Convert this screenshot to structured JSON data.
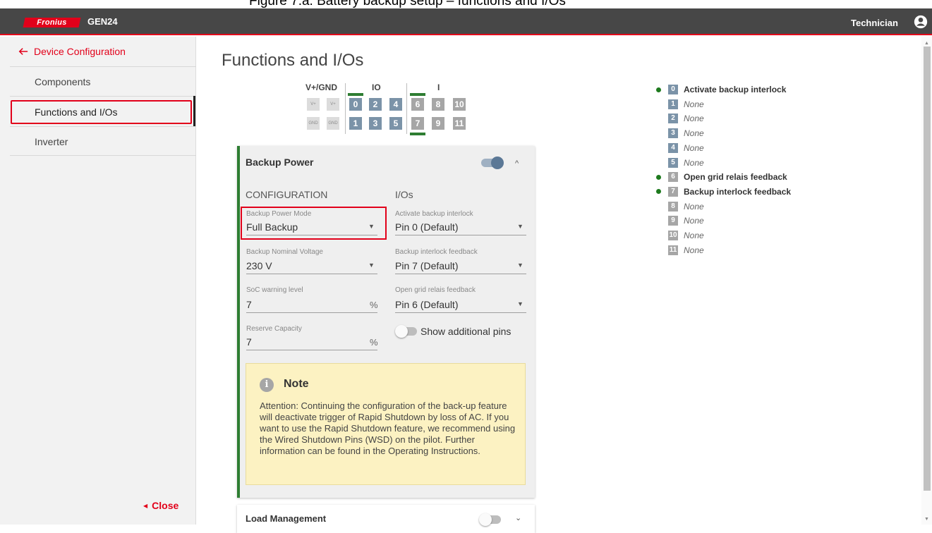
{
  "caption": "Figure 7.a: Battery backup setup – functions and I/Os",
  "header": {
    "logo_text": "Fronius",
    "product": "GEN24",
    "role": "Technician"
  },
  "sidebar": {
    "back_label": "Device Configuration",
    "items": [
      {
        "label": "Components"
      },
      {
        "label": "Functions and I/Os"
      },
      {
        "label": "Inverter"
      }
    ],
    "close_label": "Close"
  },
  "main": {
    "title": "Functions and I/Os",
    "pin_groups": {
      "vgnd": "V+/GND",
      "io": "IO",
      "i": "I"
    },
    "v_labels": [
      "V+",
      "V+"
    ],
    "gnd_labels": [
      "GND",
      "GND"
    ],
    "pins_top": [
      "0",
      "2",
      "4",
      "6",
      "8",
      "10"
    ],
    "pins_bottom": [
      "1",
      "3",
      "5",
      "7",
      "9",
      "11"
    ],
    "active_pins": [
      "0",
      "6",
      "7"
    ]
  },
  "backup": {
    "title": "Backup Power",
    "enabled": true,
    "configuration_heading": "CONFIGURATION",
    "ios_heading": "I/Os",
    "mode_label": "Backup Power Mode",
    "mode_value": "Full Backup",
    "voltage_label": "Backup Nominal Voltage",
    "voltage_value": "230 V",
    "soc_label": "SoC warning level",
    "soc_value": "7",
    "soc_unit": "%",
    "reserve_label": "Reserve Capacity",
    "reserve_value": "7",
    "reserve_unit": "%",
    "interlock_label": "Activate backup interlock",
    "interlock_value": "Pin 0 (Default)",
    "feedback_label": "Backup interlock feedback",
    "feedback_value": "Pin 7 (Default)",
    "relais_label": "Open grid relais feedback",
    "relais_value": "Pin 6 (Default)",
    "show_pins_label": "Show additional pins",
    "show_pins_enabled": false,
    "note_icon": "i",
    "note_title": "Note",
    "note_text": "Attention: Continuing the configuration of the back-up feature will deactivate trigger of Rapid Shutdown by loss of AC. If you want to use the Rapid Shutdown feature, we recommend using the Wired Shutdown Pins (WSD) on the pilot. Further information can be found in the Operating Instructions."
  },
  "load_management": {
    "title": "Load Management",
    "enabled": false
  },
  "pin_legend": [
    {
      "pin": "0",
      "label": "Activate backup interlock",
      "assigned": true
    },
    {
      "pin": "1",
      "label": "None",
      "assigned": false
    },
    {
      "pin": "2",
      "label": "None",
      "assigned": false
    },
    {
      "pin": "3",
      "label": "None",
      "assigned": false
    },
    {
      "pin": "4",
      "label": "None",
      "assigned": false
    },
    {
      "pin": "5",
      "label": "None",
      "assigned": false
    },
    {
      "pin": "6",
      "label": "Open grid relais feedback",
      "assigned": true
    },
    {
      "pin": "7",
      "label": "Backup interlock feedback",
      "assigned": true
    },
    {
      "pin": "8",
      "label": "None",
      "assigned": false
    },
    {
      "pin": "9",
      "label": "None",
      "assigned": false
    },
    {
      "pin": "10",
      "label": "None",
      "assigned": false
    },
    {
      "pin": "11",
      "label": "None",
      "assigned": false
    }
  ],
  "colors": {
    "accent": "#e2001a",
    "active_green": "#2e7d32",
    "io_pin": "#7b93a8",
    "input_pin": "#a6a6a6",
    "note_bg": "#fcf2c2"
  }
}
